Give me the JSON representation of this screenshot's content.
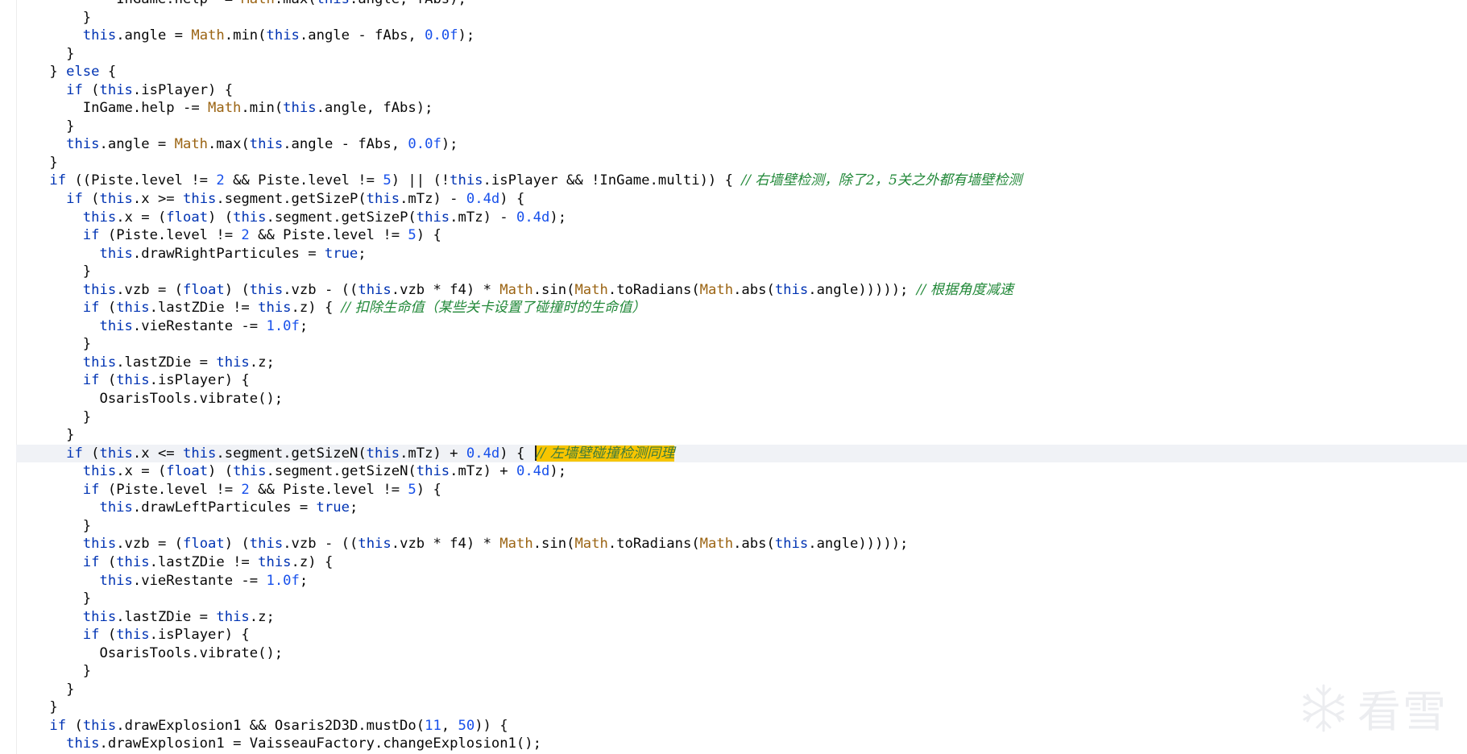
{
  "editor": {
    "lines": [
      {
        "indent": 12,
        "tokens": [
          {
            "t": "InGame.help -= ",
            "c": ""
          },
          {
            "t": "Math",
            "c": "cls"
          },
          {
            "t": ".max(",
            "c": ""
          },
          {
            "t": "this",
            "c": "kw"
          },
          {
            "t": ".angle, fAbs);",
            "c": ""
          }
        ]
      },
      {
        "indent": 8,
        "tokens": [
          {
            "t": "}",
            "c": ""
          }
        ]
      },
      {
        "indent": 8,
        "tokens": [
          {
            "t": "this",
            "c": "kw"
          },
          {
            "t": ".angle = ",
            "c": ""
          },
          {
            "t": "Math",
            "c": "cls"
          },
          {
            "t": ".min(",
            "c": ""
          },
          {
            "t": "this",
            "c": "kw"
          },
          {
            "t": ".angle - fAbs, ",
            "c": ""
          },
          {
            "t": "0.0f",
            "c": "num"
          },
          {
            "t": ");",
            "c": ""
          }
        ]
      },
      {
        "indent": 6,
        "tokens": [
          {
            "t": "}",
            "c": ""
          }
        ]
      },
      {
        "indent": 4,
        "tokens": [
          {
            "t": "} ",
            "c": ""
          },
          {
            "t": "else",
            "c": "kw"
          },
          {
            "t": " {",
            "c": ""
          }
        ]
      },
      {
        "indent": 6,
        "tokens": [
          {
            "t": "if",
            "c": "kw"
          },
          {
            "t": " (",
            "c": ""
          },
          {
            "t": "this",
            "c": "kw"
          },
          {
            "t": ".isPlayer) {",
            "c": ""
          }
        ]
      },
      {
        "indent": 8,
        "tokens": [
          {
            "t": "InGame.help -= ",
            "c": ""
          },
          {
            "t": "Math",
            "c": "cls"
          },
          {
            "t": ".min(",
            "c": ""
          },
          {
            "t": "this",
            "c": "kw"
          },
          {
            "t": ".angle, fAbs);",
            "c": ""
          }
        ]
      },
      {
        "indent": 6,
        "tokens": [
          {
            "t": "}",
            "c": ""
          }
        ]
      },
      {
        "indent": 6,
        "tokens": [
          {
            "t": "this",
            "c": "kw"
          },
          {
            "t": ".angle = ",
            "c": ""
          },
          {
            "t": "Math",
            "c": "cls"
          },
          {
            "t": ".max(",
            "c": ""
          },
          {
            "t": "this",
            "c": "kw"
          },
          {
            "t": ".angle - fAbs, ",
            "c": ""
          },
          {
            "t": "0.0f",
            "c": "num"
          },
          {
            "t": ");",
            "c": ""
          }
        ]
      },
      {
        "indent": 4,
        "tokens": [
          {
            "t": "}",
            "c": ""
          }
        ]
      },
      {
        "indent": 4,
        "tokens": [
          {
            "t": "if",
            "c": "kw"
          },
          {
            "t": " ((Piste.level != ",
            "c": ""
          },
          {
            "t": "2",
            "c": "num"
          },
          {
            "t": " && Piste.level != ",
            "c": ""
          },
          {
            "t": "5",
            "c": "num"
          },
          {
            "t": ") || (!",
            "c": ""
          },
          {
            "t": "this",
            "c": "kw"
          },
          {
            "t": ".isPlayer && !InGame.multi)) { ",
            "c": ""
          },
          {
            "t": "// 右墙壁检测，除了2，5关之外都有墙壁检测",
            "c": "cm"
          }
        ]
      },
      {
        "indent": 6,
        "tokens": [
          {
            "t": "if",
            "c": "kw"
          },
          {
            "t": " (",
            "c": ""
          },
          {
            "t": "this",
            "c": "kw"
          },
          {
            "t": ".x >= ",
            "c": ""
          },
          {
            "t": "this",
            "c": "kw"
          },
          {
            "t": ".segment.getSizeP(",
            "c": ""
          },
          {
            "t": "this",
            "c": "kw"
          },
          {
            "t": ".mTz) - ",
            "c": ""
          },
          {
            "t": "0.4d",
            "c": "num"
          },
          {
            "t": ") {",
            "c": ""
          }
        ]
      },
      {
        "indent": 8,
        "tokens": [
          {
            "t": "this",
            "c": "kw"
          },
          {
            "t": ".x = (",
            "c": ""
          },
          {
            "t": "float",
            "c": "kw"
          },
          {
            "t": ") (",
            "c": ""
          },
          {
            "t": "this",
            "c": "kw"
          },
          {
            "t": ".segment.getSizeP(",
            "c": ""
          },
          {
            "t": "this",
            "c": "kw"
          },
          {
            "t": ".mTz) - ",
            "c": ""
          },
          {
            "t": "0.4d",
            "c": "num"
          },
          {
            "t": ");",
            "c": ""
          }
        ]
      },
      {
        "indent": 8,
        "tokens": [
          {
            "t": "if",
            "c": "kw"
          },
          {
            "t": " (Piste.level != ",
            "c": ""
          },
          {
            "t": "2",
            "c": "num"
          },
          {
            "t": " && Piste.level != ",
            "c": ""
          },
          {
            "t": "5",
            "c": "num"
          },
          {
            "t": ") {",
            "c": ""
          }
        ]
      },
      {
        "indent": 10,
        "tokens": [
          {
            "t": "this",
            "c": "kw"
          },
          {
            "t": ".drawRightParticules = ",
            "c": ""
          },
          {
            "t": "true",
            "c": "kw"
          },
          {
            "t": ";",
            "c": ""
          }
        ]
      },
      {
        "indent": 8,
        "tokens": [
          {
            "t": "}",
            "c": ""
          }
        ]
      },
      {
        "indent": 8,
        "tokens": [
          {
            "t": "this",
            "c": "kw"
          },
          {
            "t": ".vzb = (",
            "c": ""
          },
          {
            "t": "float",
            "c": "kw"
          },
          {
            "t": ") (",
            "c": ""
          },
          {
            "t": "this",
            "c": "kw"
          },
          {
            "t": ".vzb - ((",
            "c": ""
          },
          {
            "t": "this",
            "c": "kw"
          },
          {
            "t": ".vzb * f4) * ",
            "c": ""
          },
          {
            "t": "Math",
            "c": "cls"
          },
          {
            "t": ".sin(",
            "c": ""
          },
          {
            "t": "Math",
            "c": "cls"
          },
          {
            "t": ".toRadians(",
            "c": ""
          },
          {
            "t": "Math",
            "c": "cls"
          },
          {
            "t": ".abs(",
            "c": ""
          },
          {
            "t": "this",
            "c": "kw"
          },
          {
            "t": ".angle))))); ",
            "c": ""
          },
          {
            "t": "// 根据角度减速",
            "c": "cm"
          }
        ]
      },
      {
        "indent": 8,
        "tokens": [
          {
            "t": "if",
            "c": "kw"
          },
          {
            "t": " (",
            "c": ""
          },
          {
            "t": "this",
            "c": "kw"
          },
          {
            "t": ".lastZDie != ",
            "c": ""
          },
          {
            "t": "this",
            "c": "kw"
          },
          {
            "t": ".z) { ",
            "c": ""
          },
          {
            "t": "// 扣除生命值（某些关卡设置了碰撞时的生命值）",
            "c": "cm"
          }
        ]
      },
      {
        "indent": 10,
        "tokens": [
          {
            "t": "this",
            "c": "kw"
          },
          {
            "t": ".vieRestante -= ",
            "c": ""
          },
          {
            "t": "1.0f",
            "c": "num"
          },
          {
            "t": ";",
            "c": ""
          }
        ]
      },
      {
        "indent": 8,
        "tokens": [
          {
            "t": "}",
            "c": ""
          }
        ]
      },
      {
        "indent": 8,
        "tokens": [
          {
            "t": "this",
            "c": "kw"
          },
          {
            "t": ".lastZDie = ",
            "c": ""
          },
          {
            "t": "this",
            "c": "kw"
          },
          {
            "t": ".z;",
            "c": ""
          }
        ]
      },
      {
        "indent": 8,
        "tokens": [
          {
            "t": "if",
            "c": "kw"
          },
          {
            "t": " (",
            "c": ""
          },
          {
            "t": "this",
            "c": "kw"
          },
          {
            "t": ".isPlayer) {",
            "c": ""
          }
        ]
      },
      {
        "indent": 10,
        "tokens": [
          {
            "t": "OsarisTools.vibrate();",
            "c": ""
          }
        ]
      },
      {
        "indent": 8,
        "tokens": [
          {
            "t": "}",
            "c": ""
          }
        ]
      },
      {
        "indent": 6,
        "tokens": [
          {
            "t": "}",
            "c": ""
          }
        ]
      },
      {
        "indent": 6,
        "current": true,
        "caret_before_last": true,
        "tokens": [
          {
            "t": "if",
            "c": "kw"
          },
          {
            "t": " (",
            "c": ""
          },
          {
            "t": "this",
            "c": "kw"
          },
          {
            "t": ".x <= ",
            "c": ""
          },
          {
            "t": "this",
            "c": "kw"
          },
          {
            "t": ".segment.getSizeN(",
            "c": ""
          },
          {
            "t": "this",
            "c": "kw"
          },
          {
            "t": ".mTz) + ",
            "c": ""
          },
          {
            "t": "0.4d",
            "c": "num"
          },
          {
            "t": ") { ",
            "c": ""
          },
          {
            "t": "// 左墙壁碰撞检测同理",
            "c": "hl"
          }
        ]
      },
      {
        "indent": 8,
        "tokens": [
          {
            "t": "this",
            "c": "kw"
          },
          {
            "t": ".x = (",
            "c": ""
          },
          {
            "t": "float",
            "c": "kw"
          },
          {
            "t": ") (",
            "c": ""
          },
          {
            "t": "this",
            "c": "kw"
          },
          {
            "t": ".segment.getSizeN(",
            "c": ""
          },
          {
            "t": "this",
            "c": "kw"
          },
          {
            "t": ".mTz) + ",
            "c": ""
          },
          {
            "t": "0.4d",
            "c": "num"
          },
          {
            "t": ");",
            "c": ""
          }
        ]
      },
      {
        "indent": 8,
        "tokens": [
          {
            "t": "if",
            "c": "kw"
          },
          {
            "t": " (Piste.level != ",
            "c": ""
          },
          {
            "t": "2",
            "c": "num"
          },
          {
            "t": " && Piste.level != ",
            "c": ""
          },
          {
            "t": "5",
            "c": "num"
          },
          {
            "t": ") {",
            "c": ""
          }
        ]
      },
      {
        "indent": 10,
        "tokens": [
          {
            "t": "this",
            "c": "kw"
          },
          {
            "t": ".drawLeftParticules = ",
            "c": ""
          },
          {
            "t": "true",
            "c": "kw"
          },
          {
            "t": ";",
            "c": ""
          }
        ]
      },
      {
        "indent": 8,
        "tokens": [
          {
            "t": "}",
            "c": ""
          }
        ]
      },
      {
        "indent": 8,
        "tokens": [
          {
            "t": "this",
            "c": "kw"
          },
          {
            "t": ".vzb = (",
            "c": ""
          },
          {
            "t": "float",
            "c": "kw"
          },
          {
            "t": ") (",
            "c": ""
          },
          {
            "t": "this",
            "c": "kw"
          },
          {
            "t": ".vzb - ((",
            "c": ""
          },
          {
            "t": "this",
            "c": "kw"
          },
          {
            "t": ".vzb * f4) * ",
            "c": ""
          },
          {
            "t": "Math",
            "c": "cls"
          },
          {
            "t": ".sin(",
            "c": ""
          },
          {
            "t": "Math",
            "c": "cls"
          },
          {
            "t": ".toRadians(",
            "c": ""
          },
          {
            "t": "Math",
            "c": "cls"
          },
          {
            "t": ".abs(",
            "c": ""
          },
          {
            "t": "this",
            "c": "kw"
          },
          {
            "t": ".angle)))));",
            "c": ""
          }
        ]
      },
      {
        "indent": 8,
        "tokens": [
          {
            "t": "if",
            "c": "kw"
          },
          {
            "t": " (",
            "c": ""
          },
          {
            "t": "this",
            "c": "kw"
          },
          {
            "t": ".lastZDie != ",
            "c": ""
          },
          {
            "t": "this",
            "c": "kw"
          },
          {
            "t": ".z) {",
            "c": ""
          }
        ]
      },
      {
        "indent": 10,
        "tokens": [
          {
            "t": "this",
            "c": "kw"
          },
          {
            "t": ".vieRestante -= ",
            "c": ""
          },
          {
            "t": "1.0f",
            "c": "num"
          },
          {
            "t": ";",
            "c": ""
          }
        ]
      },
      {
        "indent": 8,
        "tokens": [
          {
            "t": "}",
            "c": ""
          }
        ]
      },
      {
        "indent": 8,
        "tokens": [
          {
            "t": "this",
            "c": "kw"
          },
          {
            "t": ".lastZDie = ",
            "c": ""
          },
          {
            "t": "this",
            "c": "kw"
          },
          {
            "t": ".z;",
            "c": ""
          }
        ]
      },
      {
        "indent": 8,
        "tokens": [
          {
            "t": "if",
            "c": "kw"
          },
          {
            "t": " (",
            "c": ""
          },
          {
            "t": "this",
            "c": "kw"
          },
          {
            "t": ".isPlayer) {",
            "c": ""
          }
        ]
      },
      {
        "indent": 10,
        "tokens": [
          {
            "t": "OsarisTools.vibrate();",
            "c": ""
          }
        ]
      },
      {
        "indent": 8,
        "tokens": [
          {
            "t": "}",
            "c": ""
          }
        ]
      },
      {
        "indent": 6,
        "tokens": [
          {
            "t": "}",
            "c": ""
          }
        ]
      },
      {
        "indent": 4,
        "tokens": [
          {
            "t": "}",
            "c": ""
          }
        ]
      },
      {
        "indent": 4,
        "tokens": [
          {
            "t": "if",
            "c": "kw"
          },
          {
            "t": " (",
            "c": ""
          },
          {
            "t": "this",
            "c": "kw"
          },
          {
            "t": ".drawExplosion1 && Osaris2D3D.mustDo(",
            "c": ""
          },
          {
            "t": "11",
            "c": "num"
          },
          {
            "t": ", ",
            "c": ""
          },
          {
            "t": "50",
            "c": "num"
          },
          {
            "t": ")) {",
            "c": ""
          }
        ]
      },
      {
        "indent": 6,
        "tokens": [
          {
            "t": "this",
            "c": "kw"
          },
          {
            "t": ".drawExplosion1 = VaisseauFactory.changeExplosion1();",
            "c": ""
          }
        ]
      }
    ]
  },
  "watermark": {
    "text": "看雪",
    "icon": "snowflake-icon",
    "color": "#c9ccd6"
  },
  "colors": {
    "keyword": "#0033b3",
    "class": "#9b6413",
    "number": "#1750eb",
    "comment": "#218838",
    "highlight": "#f7c500",
    "current_line": "#f0f2f6"
  }
}
